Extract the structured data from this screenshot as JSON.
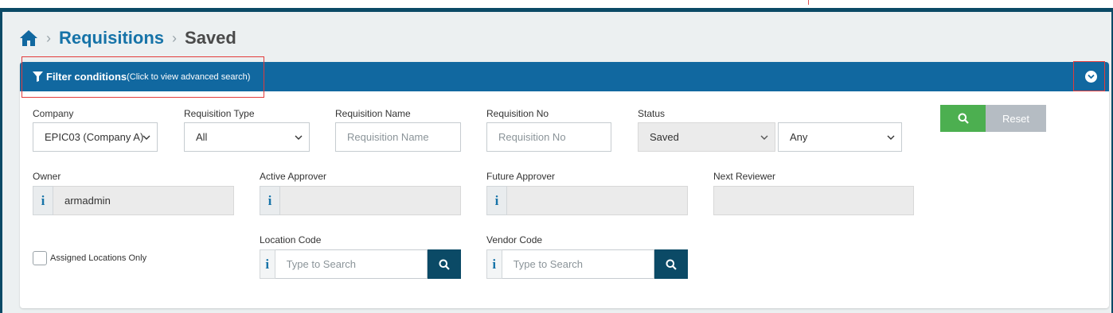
{
  "breadcrumb": {
    "home_icon": "home-icon",
    "link": "Requisitions",
    "current": "Saved"
  },
  "filter": {
    "title": "Filter conditions",
    "subtitle": "(Click to view advanced search)",
    "collapse_icon": "chevron-down-circle-icon"
  },
  "fields": {
    "company": {
      "label": "Company",
      "value": "EPIC03 (Company A)"
    },
    "requisition_type": {
      "label": "Requisition Type",
      "value": "All"
    },
    "requisition_name": {
      "label": "Requisition Name",
      "placeholder": "Requisition Name"
    },
    "requisition_no": {
      "label": "Requisition No",
      "placeholder": "Requisition No"
    },
    "status": {
      "label": "Status",
      "value": "Saved",
      "secondary_value": "Any"
    },
    "owner": {
      "label": "Owner",
      "value": "armadmin",
      "info": "i"
    },
    "active_approver": {
      "label": "Active Approver",
      "value": "",
      "info": "i"
    },
    "future_approver": {
      "label": "Future Approver",
      "value": "",
      "info": "i"
    },
    "next_reviewer": {
      "label": "Next Reviewer",
      "value": ""
    },
    "assigned_locations": {
      "label": "Assigned Locations Only",
      "checked": false
    },
    "location_code": {
      "label": "Location Code",
      "placeholder": "Type to Search",
      "info": "i"
    },
    "vendor_code": {
      "label": "Vendor Code",
      "placeholder": "Type to Search",
      "info": "i"
    }
  },
  "buttons": {
    "search_icon": "search-icon",
    "reset": "Reset"
  },
  "colors": {
    "header_blue": "#1168a0",
    "link_blue": "#1673a8",
    "dark_teal": "#0b4a66",
    "search_green": "#4caf50",
    "reset_gray": "#b5bcc3",
    "highlight_red": "#e23b3b"
  }
}
